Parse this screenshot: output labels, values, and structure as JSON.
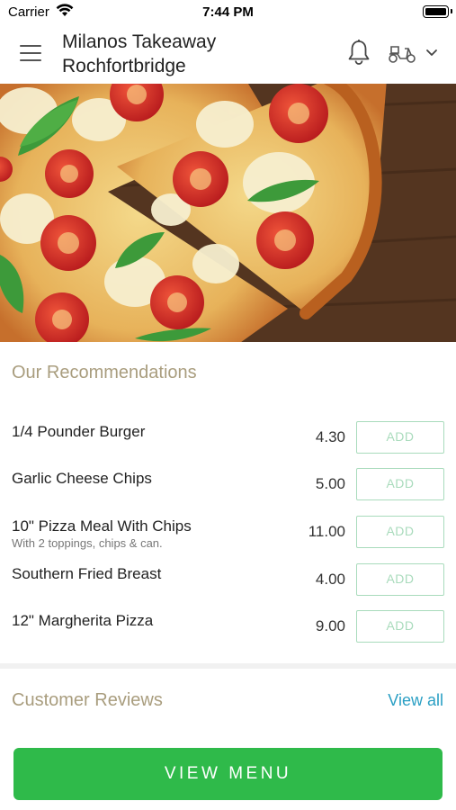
{
  "status_bar": {
    "carrier": "Carrier",
    "time": "7:44 PM"
  },
  "header": {
    "store_name_line1": "Milanos Takeaway",
    "store_name_line2": "Rochfortbridge",
    "icons": [
      "menu-icon",
      "bell-icon",
      "scooter-icon",
      "chevron-down-icon"
    ]
  },
  "recommendations": {
    "title": "Our Recommendations",
    "add_label": "ADD",
    "items": [
      {
        "name": "1/4 Pounder Burger",
        "description": "",
        "price": "4.30"
      },
      {
        "name": "Garlic Cheese Chips",
        "description": "",
        "price": "5.00"
      },
      {
        "name": "10\" Pizza Meal With Chips",
        "description": "With 2 toppings, chips & can.",
        "price": "11.00"
      },
      {
        "name": "Southern Fried Breast",
        "description": "",
        "price": "4.00"
      },
      {
        "name": "12\" Margherita Pizza",
        "description": "",
        "price": "9.00"
      }
    ]
  },
  "reviews": {
    "title": "Customer Reviews",
    "view_all": "View all"
  },
  "footer": {
    "view_menu": "VIEW MENU"
  },
  "colors": {
    "accent_green": "#2fba4a",
    "add_border": "#a9dbbc",
    "section_title": "#a99d7e",
    "link_blue": "#2a9fc4"
  }
}
